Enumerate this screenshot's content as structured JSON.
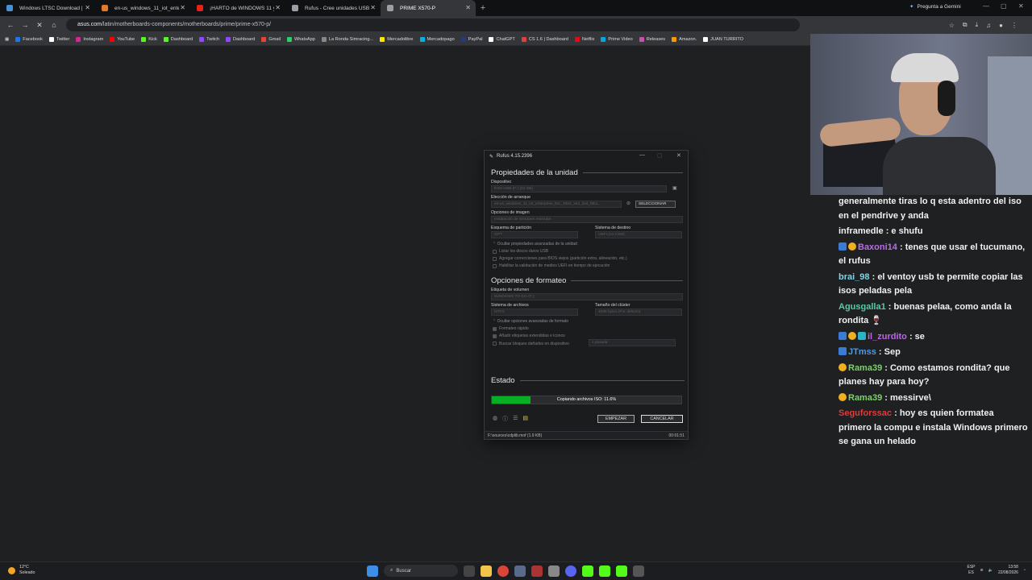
{
  "browser": {
    "tabs": [
      {
        "label": "Windows LTSC Download | MA",
        "color": "#4a90d9",
        "active": false
      },
      {
        "label": "en-us_windows_11_iot_enterp",
        "color": "#e07b2c",
        "active": false
      },
      {
        "label": "¡HARTO de WINDOWS 11 y Re",
        "color": "#e62117",
        "active": false
      },
      {
        "label": "Rufus - Cree unidades USB arr",
        "color": "#9aa0a6",
        "active": false
      },
      {
        "label": "PRIME X570-P",
        "color": "#9aa0a6",
        "active": true
      }
    ],
    "gemini_label": "Pregunta a Gemini",
    "url_domain": "asus.com",
    "url_path": "/latin/motherboards-components/motherboards/prime/prime-x570-p/",
    "bookmarks": [
      {
        "label": "Facebook",
        "color": "#1877f2"
      },
      {
        "label": "Twitter",
        "color": "#ffffff"
      },
      {
        "label": "Instagram",
        "color": "#d6249f"
      },
      {
        "label": "YouTube",
        "color": "#ff0000"
      },
      {
        "label": "Kick",
        "color": "#53fc18"
      },
      {
        "label": "Dashboard",
        "color": "#53fc18"
      },
      {
        "label": "Twitch",
        "color": "#9146ff"
      },
      {
        "label": "Dashboard",
        "color": "#9146ff"
      },
      {
        "label": "Gmail",
        "color": "#ea4335"
      },
      {
        "label": "WhatsApp",
        "color": "#25d366"
      },
      {
        "label": "La Ronda Simracing...",
        "color": "#888888"
      },
      {
        "label": "Mercadolibre",
        "color": "#ffe600"
      },
      {
        "label": "Mercadopago",
        "color": "#00b1ea"
      },
      {
        "label": "PayPal",
        "color": "#253b80"
      },
      {
        "label": "ChatGPT",
        "color": "#ffffff"
      },
      {
        "label": "CS 1.6 | Dashboard",
        "color": "#e04040"
      },
      {
        "label": "Netflix",
        "color": "#e50914"
      },
      {
        "label": "Prime Video",
        "color": "#00a8e1"
      },
      {
        "label": "Releases",
        "color": "#c94fb0"
      },
      {
        "label": "Amazon.",
        "color": "#ff9900"
      },
      {
        "label": "JUAN TURRITO",
        "color": "#ffffff"
      }
    ]
  },
  "rufus": {
    "title": "Rufus 4.15.2396",
    "drive_props_heading": "Propiedades de la unidad",
    "device_label": "Dispositivo",
    "device_value": "ESD-USB (F:) [32 GB]",
    "boot_label": "Elección de arranque",
    "boot_value": "en-us_windows_11_iot_enterprise_ltsc_2024_x64_dvd_f6b1...",
    "select_button": "SELECCIONAR",
    "image_option_label": "Opciones de imagen",
    "image_option_value": "Instalación de Windows estándar",
    "partition_label": "Esquema de partición",
    "partition_value": "GPT",
    "target_label": "Sistema de destino",
    "target_value": "UEFI (no CSM)",
    "adv_drive_toggle": "Ocultar propiedades avanzadas de la unidad",
    "check_list_usb": "Listar los discos duros USB",
    "check_bios": "Agregar correcciones para BIOS viejos (partición extra, alineación, etc.)",
    "check_uefi": "Habilitar la validación de medios UEFI en tiempo de ejecución",
    "format_heading": "Opciones de formateo",
    "volume_label": "Etiqueta de volumen",
    "volume_value": "WINDOWS TO GO (F:)",
    "fs_label": "Sistema de archivos",
    "fs_value": "NTFS",
    "cluster_label": "Tamaño del clúster",
    "cluster_value": "4096 bytes (Por defecto)",
    "adv_format_toggle": "Ocultar opciones avanzadas de formato",
    "check_quick": "Formateo rápido",
    "check_ext": "Añadir etiquetas extendidas e iconos",
    "check_bad": "Buscar bloques dañados en dispositivo",
    "passes_value": "1 pasada",
    "status_heading": "Estado",
    "progress_text": "Copiando archivos ISO: 11.6%",
    "progress_fraction": 0.206,
    "start_button": "EMPEZAR",
    "cancel_button": "CANCELAR",
    "status_file": "F:\\sources\\cdplib.mof (1.9 KB)",
    "status_time": "00:01:51"
  },
  "chat": [
    {
      "user": "",
      "text": "generalmente tiras lo q esta adentro del iso en el pendrive y anda",
      "color": "#f1f1f1",
      "badges": []
    },
    {
      "user": "inframedle",
      "text": ": e shufu",
      "color": "#f1f1f1",
      "badges": []
    },
    {
      "user": "Baxoni14",
      "text": ": tenes que usar el tucumano, el rufus",
      "color": "#b86ee6",
      "badges": [
        "arrow",
        "one"
      ]
    },
    {
      "user": "brai_98",
      "text": ": el ventoy usb te permite copiar las isos peladas pela",
      "color": "#7fd3e8",
      "badges": []
    },
    {
      "user": "Agusgalla1",
      "text": ": buenas pelaa, como anda la rondita 🍷",
      "color": "#58c9a8",
      "badges": []
    },
    {
      "user": "il_zurdito",
      "text": ": se",
      "color": "#c065e8",
      "badges": [
        "arrow",
        "one",
        "bits"
      ]
    },
    {
      "user": "JTmss",
      "text": ": Sep",
      "color": "#4a9be8",
      "badges": [
        "arrow"
      ]
    },
    {
      "user": "Rama39",
      "text": ": Como estamos rondita? que planes hay para hoy?",
      "color": "#7ed06b",
      "badges": [
        "one"
      ]
    },
    {
      "user": "Rama39",
      "text": ": messirve\\",
      "color": "#7ed06b",
      "badges": [
        "one"
      ]
    },
    {
      "user": "Seguforssac",
      "text": ": hoy es quien formatea primero la compu e instala Windows primero se gana un helado",
      "color": "#e03a3a",
      "badges": []
    }
  ],
  "taskbar": {
    "temp": "12°C",
    "weather": "Soleado",
    "search_placeholder": "Buscar",
    "lang_top": "ESP",
    "lang_bottom": "ES",
    "time": "13:58",
    "date": "22/08/2026"
  }
}
